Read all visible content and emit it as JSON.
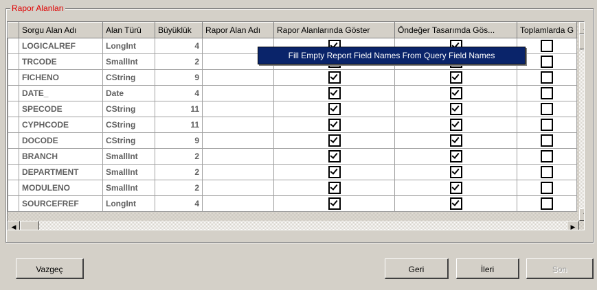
{
  "group": {
    "title": "Rapor Alanları"
  },
  "columns": [
    "Sorgu Alan Adı",
    "Alan Türü",
    "Büyüklük",
    "Rapor Alan Adı",
    "Rapor Alanlarında Göster",
    "Öndeğer Tasarımda Gös...",
    "Toplamlarda G"
  ],
  "rows": [
    {
      "name": "LOGICALREF",
      "type": "LongInt",
      "size": "4",
      "report_name": "",
      "show": true,
      "default_design": true,
      "totals": false
    },
    {
      "name": "TRCODE",
      "type": "SmallInt",
      "size": "2",
      "report_name": "",
      "show": true,
      "default_design": true,
      "totals": false
    },
    {
      "name": "FICHENO",
      "type": "CString",
      "size": "9",
      "report_name": "",
      "show": true,
      "default_design": true,
      "totals": false
    },
    {
      "name": "DATE_",
      "type": "Date",
      "size": "4",
      "report_name": "",
      "show": true,
      "default_design": true,
      "totals": false
    },
    {
      "name": "SPECODE",
      "type": "CString",
      "size": "11",
      "report_name": "",
      "show": true,
      "default_design": true,
      "totals": false
    },
    {
      "name": "CYPHCODE",
      "type": "CString",
      "size": "11",
      "report_name": "",
      "show": true,
      "default_design": true,
      "totals": false
    },
    {
      "name": "DOCODE",
      "type": "CString",
      "size": "9",
      "report_name": "",
      "show": true,
      "default_design": true,
      "totals": false
    },
    {
      "name": "BRANCH",
      "type": "SmallInt",
      "size": "2",
      "report_name": "",
      "show": true,
      "default_design": true,
      "totals": false
    },
    {
      "name": "DEPARTMENT",
      "type": "SmallInt",
      "size": "2",
      "report_name": "",
      "show": true,
      "default_design": true,
      "totals": false
    },
    {
      "name": "MODULENO",
      "type": "SmallInt",
      "size": "2",
      "report_name": "",
      "show": true,
      "default_design": true,
      "totals": false
    },
    {
      "name": "SOURCEFREF",
      "type": "LongInt",
      "size": "4",
      "report_name": "",
      "show": true,
      "default_design": true,
      "totals": false
    }
  ],
  "context_menu": {
    "item": "Fill Empty Report Field Names From Query Field Names"
  },
  "buttons": {
    "cancel": "Vazgeç",
    "back": "Geri",
    "next": "İleri",
    "finish": "Son"
  },
  "icons": {
    "scroll_up": "arrow-up-icon",
    "scroll_down": "arrow-down-icon",
    "scroll_left": "arrow-left-icon",
    "scroll_right": "arrow-right-icon"
  }
}
